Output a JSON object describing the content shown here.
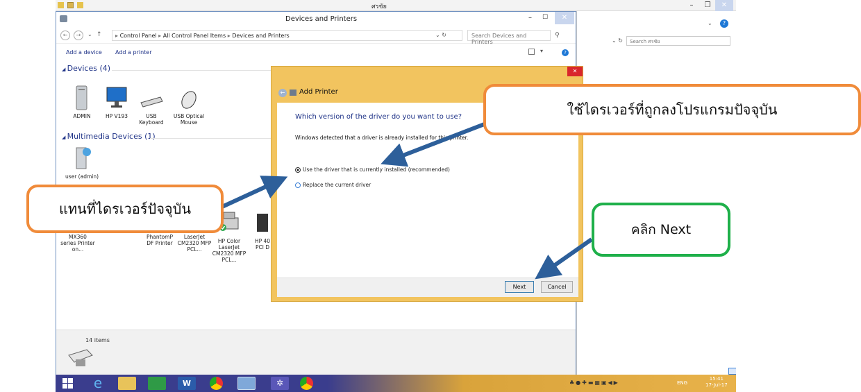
{
  "bg_window": {
    "title": "ศรชัย",
    "search_placeholder": "Search ศรชัย"
  },
  "devices_window": {
    "title": "Devices and Printers",
    "breadcrumb": [
      "Control Panel",
      "All Control Panel Items",
      "Devices and Printers"
    ],
    "search_placeholder": "Search Devices and Printers",
    "commands": {
      "add_device": "Add a device",
      "add_printer": "Add a printer"
    },
    "groups": {
      "devices_header": "Devices (4)",
      "multimedia_header": "Multimedia Devices (1)"
    },
    "devices": [
      {
        "label": "ADMIN"
      },
      {
        "label": "HP V193"
      },
      {
        "label": "USB Keyboard"
      },
      {
        "label": "USB Optical Mouse"
      }
    ],
    "multimedia": [
      {
        "label": "user (admin)"
      }
    ],
    "printers": [
      {
        "label": "MX360 series Printer on..."
      },
      {
        "label": "PhantomP DF Printer"
      },
      {
        "label": "LaserJet CM2320 MFP PCL..."
      },
      {
        "label": "HP Color LaserJet CM2320 MFP PCL..."
      },
      {
        "label": "HP 40 PCl D"
      }
    ],
    "status": "14 items"
  },
  "dialog": {
    "title": "Add Printer",
    "heading": "Which version of the driver do you want to use?",
    "info": "Windows detected that a driver is already installed for this printer.",
    "options": [
      {
        "label": "Use the driver that is currently installed (recommended)",
        "checked": true
      },
      {
        "label": "Replace the current driver",
        "checked": false
      }
    ],
    "next_label": "Next",
    "cancel_label": "Cancel",
    "close_glyph": "✕"
  },
  "taskbar": {
    "lang": "ENG",
    "time": "15:41",
    "date": "17-Jul-17"
  },
  "callouts": {
    "use_current": "ใช้ไดรเวอร์ที่ถูกลงโปรแกรมปัจจุบัน",
    "replace": "แทนที่ไดรเวอร์ปัจจุบัน",
    "click_next": "คลิก Next"
  },
  "colors": {
    "dialog_frame": "#f2c45f",
    "link_blue": "#1e3287",
    "callout_orange": "#f08b3a",
    "callout_green": "#1fb04a",
    "arrow": "#2d5f9a"
  }
}
